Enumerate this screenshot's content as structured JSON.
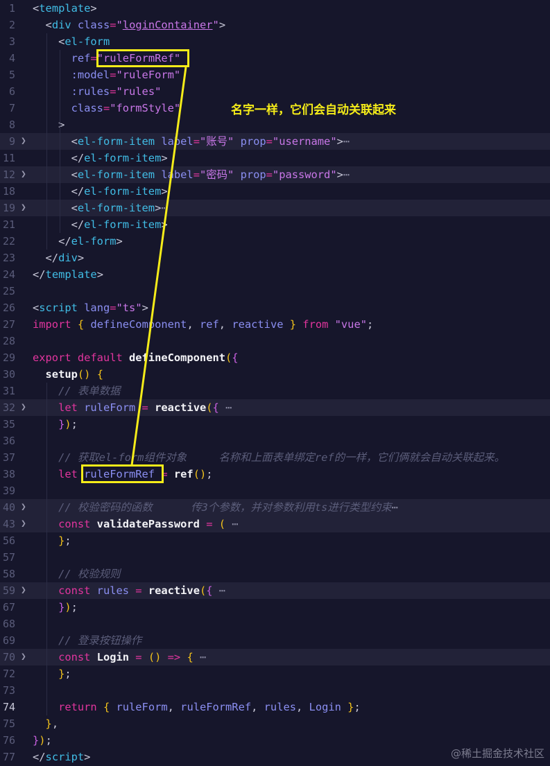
{
  "annotation": {
    "note": "名字一样，它们会自动关联起来",
    "color": "#f5ec19"
  },
  "watermark": "@稀土掘金技术社区",
  "active_line": "74",
  "lines": [
    {
      "n": "1",
      "tokens": [
        [
          "p",
          "<"
        ],
        [
          "t",
          "template"
        ],
        [
          "p",
          ">"
        ]
      ]
    },
    {
      "n": "2",
      "tokens": [
        [
          "p",
          "  <"
        ],
        [
          "t",
          "div"
        ],
        [
          "a",
          " class"
        ],
        [
          "k",
          "="
        ],
        [
          "s",
          "\""
        ],
        [
          "s u",
          "loginContainer"
        ],
        [
          "s",
          "\""
        ],
        [
          "p",
          ">"
        ]
      ]
    },
    {
      "n": "3",
      "tokens": [
        [
          "p",
          "    <"
        ],
        [
          "t",
          "el-form"
        ]
      ]
    },
    {
      "n": "4",
      "tokens": [
        [
          "a",
          "      ref"
        ],
        [
          "k",
          "="
        ],
        [
          "s",
          "\"ruleFormRef\""
        ]
      ]
    },
    {
      "n": "5",
      "tokens": [
        [
          "a",
          "      :model"
        ],
        [
          "k",
          "="
        ],
        [
          "s",
          "\"ruleForm\""
        ]
      ]
    },
    {
      "n": "6",
      "tokens": [
        [
          "a",
          "      :rules"
        ],
        [
          "k",
          "="
        ],
        [
          "s",
          "\"rules\""
        ]
      ]
    },
    {
      "n": "7",
      "tokens": [
        [
          "a",
          "      class"
        ],
        [
          "k",
          "="
        ],
        [
          "s",
          "\"formStyle\""
        ]
      ]
    },
    {
      "n": "8",
      "tokens": [
        [
          "p",
          "    >"
        ]
      ]
    },
    {
      "n": "9",
      "folded": true,
      "tokens": [
        [
          "p",
          "      <"
        ],
        [
          "t",
          "el-form-item"
        ],
        [
          "a",
          " label"
        ],
        [
          "k",
          "="
        ],
        [
          "s",
          "\"账号\""
        ],
        [
          "a",
          " prop"
        ],
        [
          "k",
          "="
        ],
        [
          "s",
          "\"username\""
        ],
        [
          "p",
          ">"
        ],
        [
          "e",
          "⋯"
        ]
      ]
    },
    {
      "n": "11",
      "tokens": [
        [
          "p",
          "      </"
        ],
        [
          "t",
          "el-form-item"
        ],
        [
          "p",
          ">"
        ]
      ]
    },
    {
      "n": "12",
      "folded": true,
      "tokens": [
        [
          "p",
          "      <"
        ],
        [
          "t",
          "el-form-item"
        ],
        [
          "a",
          " label"
        ],
        [
          "k",
          "="
        ],
        [
          "s",
          "\"密码\""
        ],
        [
          "a",
          " prop"
        ],
        [
          "k",
          "="
        ],
        [
          "s",
          "\"password\""
        ],
        [
          "p",
          ">"
        ],
        [
          "e",
          "⋯"
        ]
      ]
    },
    {
      "n": "18",
      "tokens": [
        [
          "p",
          "      </"
        ],
        [
          "t",
          "el-form-item"
        ],
        [
          "p",
          ">"
        ]
      ]
    },
    {
      "n": "19",
      "folded": true,
      "tokens": [
        [
          "p",
          "      <"
        ],
        [
          "t",
          "el-form-item"
        ],
        [
          "p",
          ">"
        ],
        [
          "e",
          "⋯"
        ]
      ]
    },
    {
      "n": "21",
      "tokens": [
        [
          "p",
          "      </"
        ],
        [
          "t",
          "el-form-item"
        ],
        [
          "p",
          ">"
        ]
      ]
    },
    {
      "n": "22",
      "tokens": [
        [
          "p",
          "    </"
        ],
        [
          "t",
          "el-form"
        ],
        [
          "p",
          ">"
        ]
      ]
    },
    {
      "n": "23",
      "tokens": [
        [
          "p",
          "  </"
        ],
        [
          "t",
          "div"
        ],
        [
          "p",
          ">"
        ]
      ]
    },
    {
      "n": "24",
      "tokens": [
        [
          "p",
          "</"
        ],
        [
          "t",
          "template"
        ],
        [
          "p",
          ">"
        ]
      ]
    },
    {
      "n": "25",
      "tokens": []
    },
    {
      "n": "26",
      "tokens": [
        [
          "p",
          "<"
        ],
        [
          "t",
          "script"
        ],
        [
          "a",
          " lang"
        ],
        [
          "k",
          "="
        ],
        [
          "s",
          "\"ts\""
        ],
        [
          "p",
          ">"
        ]
      ]
    },
    {
      "n": "27",
      "tokens": [
        [
          "k",
          "import"
        ],
        [
          "b",
          " {"
        ],
        [
          "p",
          " "
        ],
        [
          "v",
          "defineComponent"
        ],
        [
          "p",
          ", "
        ],
        [
          "v",
          "ref"
        ],
        [
          "p",
          ", "
        ],
        [
          "v",
          "reactive"
        ],
        [
          "b",
          " }"
        ],
        [
          "k",
          " from"
        ],
        [
          "s",
          " \"vue\""
        ],
        [
          "p",
          ";"
        ]
      ]
    },
    {
      "n": "28",
      "tokens": []
    },
    {
      "n": "29",
      "tokens": [
        [
          "k",
          "export default"
        ],
        [
          "f",
          " defineComponent"
        ],
        [
          "b",
          "("
        ],
        [
          "bp",
          "{"
        ]
      ]
    },
    {
      "n": "30",
      "tokens": [
        [
          "f",
          "  setup"
        ],
        [
          "b",
          "()"
        ],
        [
          "b",
          " {"
        ]
      ]
    },
    {
      "n": "31",
      "tokens": [
        [
          "c",
          "    // 表单数据"
        ]
      ]
    },
    {
      "n": "32",
      "folded": true,
      "tokens": [
        [
          "k",
          "    let"
        ],
        [
          "v",
          " ruleForm"
        ],
        [
          "k",
          " ="
        ],
        [
          "f",
          " reactive"
        ],
        [
          "b",
          "("
        ],
        [
          "bp",
          "{"
        ],
        [
          "e",
          " ⋯"
        ]
      ]
    },
    {
      "n": "35",
      "tokens": [
        [
          "bp",
          "    }"
        ],
        [
          "b",
          ")"
        ],
        [
          "p",
          ";"
        ]
      ]
    },
    {
      "n": "36",
      "tokens": []
    },
    {
      "n": "37",
      "tokens": [
        [
          "c",
          "    // 获取el-form组件对象     名称和上面表单绑定ref的一样，它们俩就会自动关联起来。"
        ]
      ]
    },
    {
      "n": "38",
      "tokens": [
        [
          "k",
          "    let"
        ],
        [
          "v",
          " ruleFormRef"
        ],
        [
          "k",
          " ="
        ],
        [
          "f",
          " ref"
        ],
        [
          "b",
          "()"
        ],
        [
          "p",
          ";"
        ]
      ]
    },
    {
      "n": "39",
      "tokens": []
    },
    {
      "n": "40",
      "folded": true,
      "tokens": [
        [
          "c",
          "    // 校验密码的函数      传3个参数，并对参数利用ts进行类型约束"
        ],
        [
          "e",
          "⋯"
        ]
      ]
    },
    {
      "n": "43",
      "folded": true,
      "tokens": [
        [
          "k",
          "    const"
        ],
        [
          "f",
          " validatePassword"
        ],
        [
          "k",
          " ="
        ],
        [
          "b",
          " ("
        ],
        [
          "e",
          " ⋯"
        ]
      ]
    },
    {
      "n": "56",
      "tokens": [
        [
          "b",
          "    }"
        ],
        [
          "p",
          ";"
        ]
      ]
    },
    {
      "n": "57",
      "tokens": []
    },
    {
      "n": "58",
      "tokens": [
        [
          "c",
          "    // 校验规则"
        ]
      ]
    },
    {
      "n": "59",
      "folded": true,
      "tokens": [
        [
          "k",
          "    const"
        ],
        [
          "v",
          " rules"
        ],
        [
          "k",
          " ="
        ],
        [
          "f",
          " reactive"
        ],
        [
          "b",
          "("
        ],
        [
          "bp",
          "{"
        ],
        [
          "e",
          " ⋯"
        ]
      ]
    },
    {
      "n": "67",
      "tokens": [
        [
          "bp",
          "    }"
        ],
        [
          "b",
          ")"
        ],
        [
          "p",
          ";"
        ]
      ]
    },
    {
      "n": "68",
      "tokens": []
    },
    {
      "n": "69",
      "tokens": [
        [
          "c",
          "    // 登录按钮操作"
        ]
      ]
    },
    {
      "n": "70",
      "folded": true,
      "tokens": [
        [
          "k",
          "    const"
        ],
        [
          "f",
          " Login"
        ],
        [
          "k",
          " ="
        ],
        [
          "b",
          " ()"
        ],
        [
          "k",
          " =>"
        ],
        [
          "b",
          " {"
        ],
        [
          "e",
          " ⋯"
        ]
      ]
    },
    {
      "n": "72",
      "tokens": [
        [
          "b",
          "    }"
        ],
        [
          "p",
          ";"
        ]
      ]
    },
    {
      "n": "73",
      "tokens": []
    },
    {
      "n": "74",
      "tokens": [
        [
          "k",
          "    return"
        ],
        [
          "b",
          " {"
        ],
        [
          "v",
          " ruleForm"
        ],
        [
          "p",
          ","
        ],
        [
          "v",
          " ruleFormRef"
        ],
        [
          "p",
          ","
        ],
        [
          "v",
          " rules"
        ],
        [
          "p",
          ","
        ],
        [
          "v",
          " Login"
        ],
        [
          "b",
          " }"
        ],
        [
          "p",
          ";"
        ]
      ]
    },
    {
      "n": "75",
      "tokens": [
        [
          "b",
          "  }"
        ],
        [
          "p",
          ","
        ]
      ]
    },
    {
      "n": "76",
      "tokens": [
        [
          "bp",
          "}"
        ],
        [
          "b",
          ")"
        ],
        [
          "p",
          ";"
        ]
      ]
    },
    {
      "n": "77",
      "tokens": [
        [
          "p",
          "</"
        ],
        [
          "t",
          "script"
        ],
        [
          "p",
          ">"
        ]
      ]
    }
  ]
}
